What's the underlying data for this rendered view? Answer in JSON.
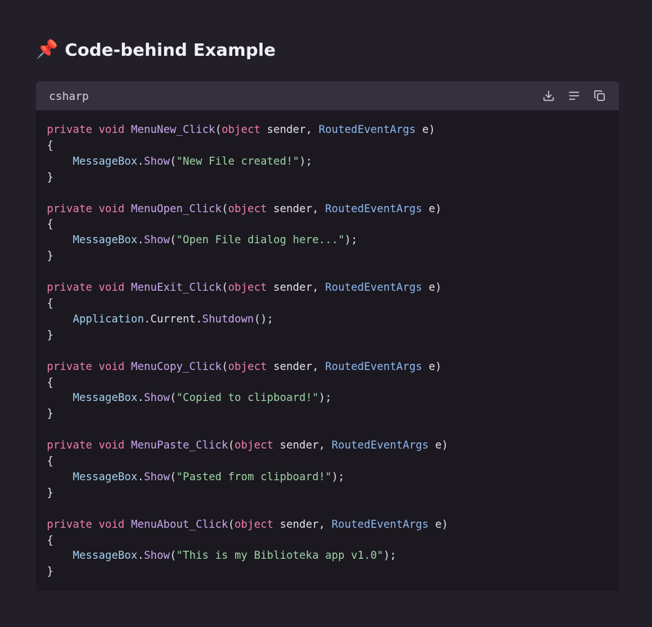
{
  "heading": {
    "icon": "pushpin-icon",
    "emoji": "📌",
    "text": "Code-behind Example"
  },
  "code_block": {
    "language": "csharp",
    "toolbar": {
      "download": "download-icon",
      "wrap": "wrap-lines-icon",
      "copy": "copy-icon"
    },
    "colors": {
      "keyword": "#f07fae",
      "function": "#c9a9ec",
      "type": "#8fb9ef",
      "string": "#9ed3a6",
      "header_bg": "#34303d",
      "body_bg": "#1b1820"
    },
    "methods": [
      {
        "mod": "private",
        "ret": "void",
        "name": "MenuNew_Click",
        "param1_type": "object",
        "param1": "sender,",
        "param2_type": "RoutedEventArgs",
        "param2": "e)",
        "open": "{",
        "close": "}",
        "body_obj": "MessageBox",
        "body_member": "",
        "body_call": "Show",
        "body_arg": "\"New File created!\"",
        "body_end": ");"
      },
      {
        "mod": "private",
        "ret": "void",
        "name": "MenuOpen_Click",
        "param1_type": "object",
        "param1": "sender,",
        "param2_type": "RoutedEventArgs",
        "param2": "e)",
        "open": "{",
        "close": "}",
        "body_obj": "MessageBox",
        "body_member": "",
        "body_call": "Show",
        "body_arg": "\"Open File dialog here...\"",
        "body_end": ");"
      },
      {
        "mod": "private",
        "ret": "void",
        "name": "MenuExit_Click",
        "param1_type": "object",
        "param1": "sender,",
        "param2_type": "RoutedEventArgs",
        "param2": "e)",
        "open": "{",
        "close": "}",
        "body_obj": "Application",
        "body_member": "Current",
        "body_call": "Shutdown",
        "body_arg": "",
        "body_end": ");"
      },
      {
        "mod": "private",
        "ret": "void",
        "name": "MenuCopy_Click",
        "param1_type": "object",
        "param1": "sender,",
        "param2_type": "RoutedEventArgs",
        "param2": "e)",
        "open": "{",
        "close": "}",
        "body_obj": "MessageBox",
        "body_member": "",
        "body_call": "Show",
        "body_arg": "\"Copied to clipboard!\"",
        "body_end": ");"
      },
      {
        "mod": "private",
        "ret": "void",
        "name": "MenuPaste_Click",
        "param1_type": "object",
        "param1": "sender,",
        "param2_type": "RoutedEventArgs",
        "param2": "e)",
        "open": "{",
        "close": "}",
        "body_obj": "MessageBox",
        "body_member": "",
        "body_call": "Show",
        "body_arg": "\"Pasted from clipboard!\"",
        "body_end": ");"
      },
      {
        "mod": "private",
        "ret": "void",
        "name": "MenuAbout_Click",
        "param1_type": "object",
        "param1": "sender,",
        "param2_type": "RoutedEventArgs",
        "param2": "e)",
        "open": "{",
        "close": "}",
        "body_obj": "MessageBox",
        "body_member": "",
        "body_call": "Show",
        "body_arg": "\"This is my Biblioteka app v1.0\"",
        "body_end": ");"
      }
    ]
  }
}
